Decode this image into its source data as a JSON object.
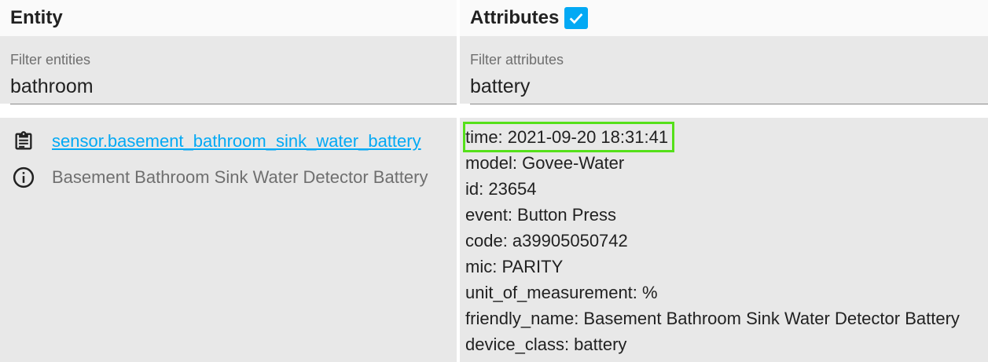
{
  "entity_column": {
    "title": "Entity",
    "filter_label": "Filter entities",
    "filter_value": "bathroom",
    "entity_id": "sensor.basement_bathroom_sink_water_battery",
    "friendly_name": "Basement Bathroom Sink Water Detector Battery",
    "icons": [
      "clipboard-copy-icon",
      "info-icon"
    ]
  },
  "attributes_column": {
    "title": "Attributes",
    "show_attributes_checked": true,
    "filter_label": "Filter attributes",
    "filter_value": "battery",
    "attributes": [
      "time: 2021-09-20 18:31:41",
      "model: Govee-Water",
      "id: 23654",
      "event: Button Press",
      "code: a39905050742",
      "mic: PARITY",
      "unit_of_measurement: %",
      "friendly_name: Basement Bathroom Sink Water Detector Battery",
      "device_class: battery"
    ],
    "highlight_color": "#55e01a"
  },
  "colors": {
    "accent": "#03a9f4",
    "panel_bg": "#e8e8e8",
    "header_bg": "#fafafa"
  }
}
